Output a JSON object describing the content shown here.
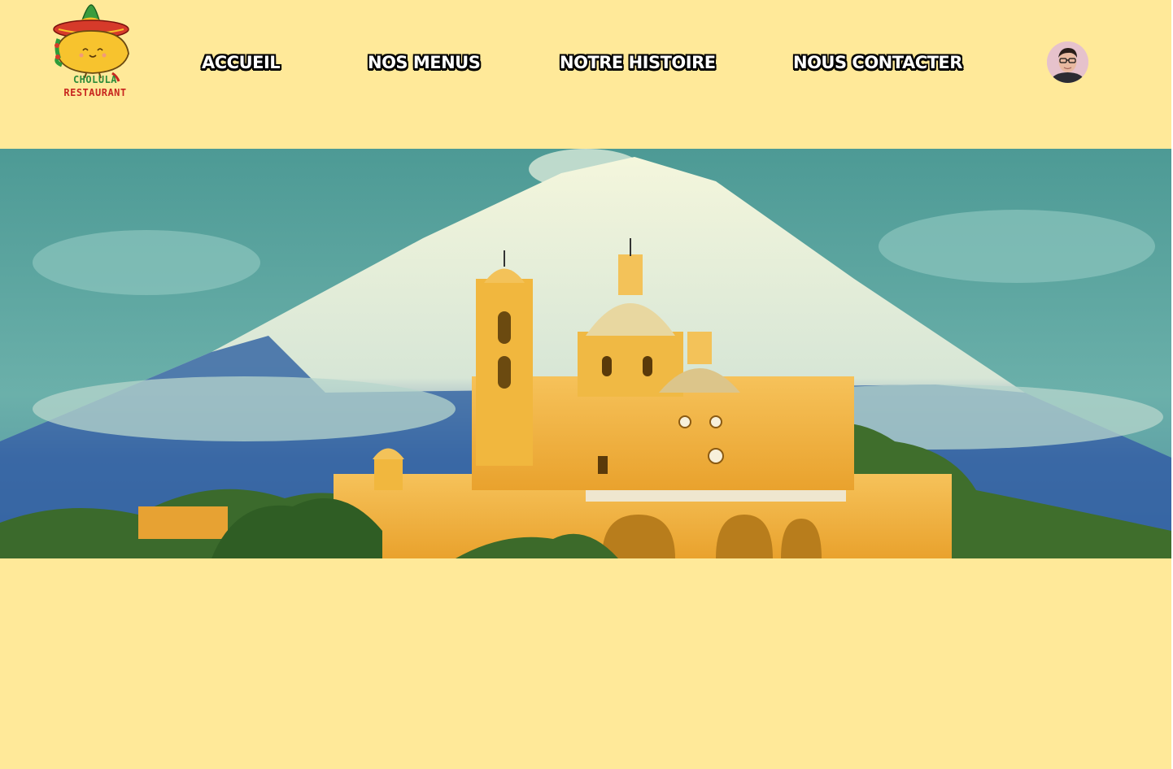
{
  "brand": {
    "line1": "CHOLULA",
    "line2": "RESTAURANT",
    "logo_icon": "sombrero-taco-mascot-icon"
  },
  "nav": {
    "items": [
      {
        "label": "ACCUEIL"
      },
      {
        "label": "NOS MENUS"
      },
      {
        "label": "NOTRE HISTOIRE"
      },
      {
        "label": "NOUS CONTACTER"
      }
    ]
  },
  "user": {
    "avatar_icon": "user-avatar-icon"
  },
  "hero": {
    "image_subject": "church-and-volcano-image"
  },
  "colors": {
    "background": "#ffe999",
    "nav_text": "#ffffff",
    "nav_outline": "#000000",
    "brand_green": "#2e8b3a",
    "brand_red": "#c8261f"
  }
}
